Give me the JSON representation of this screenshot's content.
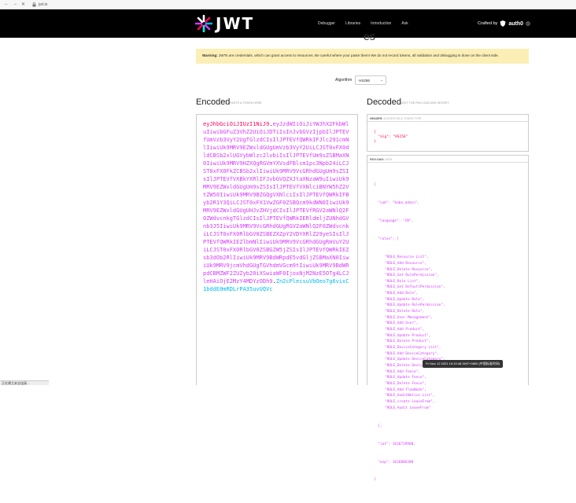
{
  "browser": {
    "url": "jwt.io",
    "nav_back": "←",
    "nav_forward": "→",
    "nav_reload": "✕"
  },
  "nav": {
    "logo_text": "JWT",
    "menu": [
      "Debugger",
      "Libraries",
      "Introduction",
      "Ask"
    ],
    "crafted_by": "Crafted by",
    "brand": "auth0"
  },
  "partial_heading": "es",
  "warning": {
    "bold": "Warning:",
    "text": " JWTs are credentials, which can grant access to resources. Be careful where your paste them! We do not record tokens, all validation and debugging is done on the client side."
  },
  "algorithm": {
    "label": "Algorithm",
    "value": "HS256"
  },
  "encoded": {
    "title": "Encoded",
    "subtitle": "PASTE A TOKEN HERE",
    "header_part": "eyJhbGciOiJIUzI1NiJ9",
    "payload_part": "eyJzdWIiOiJiYWJhX2FkbWluIiwibGFuZ3VhZ2UiOiJDTiIsInJvbGVzIjpbIlJPTEVfUmVzb3VyY2UgTGlzdCIsIlJPTEVfQWRkIFJlc291cmNlIiwiUk9MRV9EZWxldGUgUmVzb3VyY2UiLCJST0xFX0dldCBSb2xlUGVybWlzc2lvbiIsIlJPTEVfUm9sZSBMaXN0IiwiUk9MRV9HZXQgRGVmYXVsdFBlcm1pc3Npb24iLCJST0xFX0FkZCBSb2xlIiwiUk9MRV9VcGRhdGUgUm9sZSIsIlJPTEVfVXBkYXRlIFJvbGVQZXJtaXNzaW9uIiwiUk9MRV9EZWxldGUgUm9sZSIsIlJPTEVfVXNlciBNYW5hZ2VtZW50IiwiUk9MRV9BZGQgVXNlciIsIlJPTEVfQWRkIFByb2R1Y3QiLCJST0xFX1VwZGF0ZSBQcm9kdWN0IiwiUk9MRV9EZWxldGUgUHJvZHVjdCIsIlJPTEVfRGV2aWNlQ2F0ZWdvcnkgTGlzdCIsIlJPTEVfQWRkIERldmljZUNhdGVnb3J5IiwiUk9MRV9VcGRhdGUgRGV2aWNlQ2F0ZWdvcnkiLCJST0xFX0RlbGV0ZSBEZXZpY2VDYXRlZ29yeSIsIlJPTEVfQWRkIEZlbmNlIiwiUk9MRV9VcGRhdGUgRmVuY2UiLCJST0xFX0RlbGV0ZSBGZW5jZSIsIlJPTEVfQWRkIEZsb3dOb2RlIiwiUk9MRV9BdWRpdE5vdGljZSBMaXN0IiwiUk9MRV9jcmVhdGUgTGVhdmVGcm9tIiwiUk9MRV9BdWRpdCBMZWF2ZUZyb20iXSwiaWF0IjoxNjM2NzE5OTg4LCJleHAiOjE2MzY4MDYzODh9",
    "signature_part": "Zn2cPlecsuVbOeo7g6vixC1bddE0mRDLrPA35uvUQVc"
  },
  "decoded": {
    "title": "Decoded",
    "subtitle": "EDIT THE PAYLOAD AND SECRET",
    "header_label": "HEADER:",
    "header_sublabel": "ALGORITHM & TOKEN TYPE",
    "header_lines": [
      "{",
      "  \"alg\": \"HS256\"",
      "}"
    ],
    "payload_label": "PAYLOAD:",
    "payload_sublabel": "DATA",
    "payload_top": [
      "{",
      "  \"sub\": \"baba_admin\",",
      "  \"language\": \"CN\",",
      "  \"roles\": ["
    ],
    "roles": [
      "\"ROLE_Resource List\",",
      "\"ROLE_Add Resource\",",
      "\"ROLE_Delete Resource\",",
      "\"ROLE_Get RolePermission\",",
      "\"ROLE_Role List\",",
      "\"ROLE_Get DefaultPermission\",",
      "\"ROLE_Add Role\",",
      "\"ROLE_Update Role\",",
      "\"ROLE_Update RolePermission\",",
      "\"ROLE_Delete Role\",",
      "\"ROLE_User Management\",",
      "\"ROLE_Add User\",",
      "\"ROLE_Add Product\",",
      "\"ROLE_Update Product\",",
      "\"ROLE_Delete Product\",",
      "\"ROLE_DeviceCategory List\",",
      "\"ROLE_Add DeviceCategory\",",
      "\"ROLE_Update DeviceCategory\",",
      "\"ROLE_Delete DeviceCategory\",",
      "\"ROLE_Add Fence\",",
      "\"ROLE_Update Fence\",",
      "\"ROLE_Delete Fence\",",
      "\"ROLE_Add FlowNode\",",
      "\"ROLE_AuditNotice List\",",
      "\"ROLE_create LeaveFrom\",",
      "\"ROLE_Audit LeaveFrom\""
    ],
    "payload_bottom": [
      "  ],",
      "  \"iat\": 1636719988,",
      "  \"exp\": 1636806388",
      "}"
    ]
  },
  "tooltip": "Fri Nov 12 2021 19:19:48 GMT+0800 (中国标准时间)",
  "status": "正在建立安全连接..."
}
